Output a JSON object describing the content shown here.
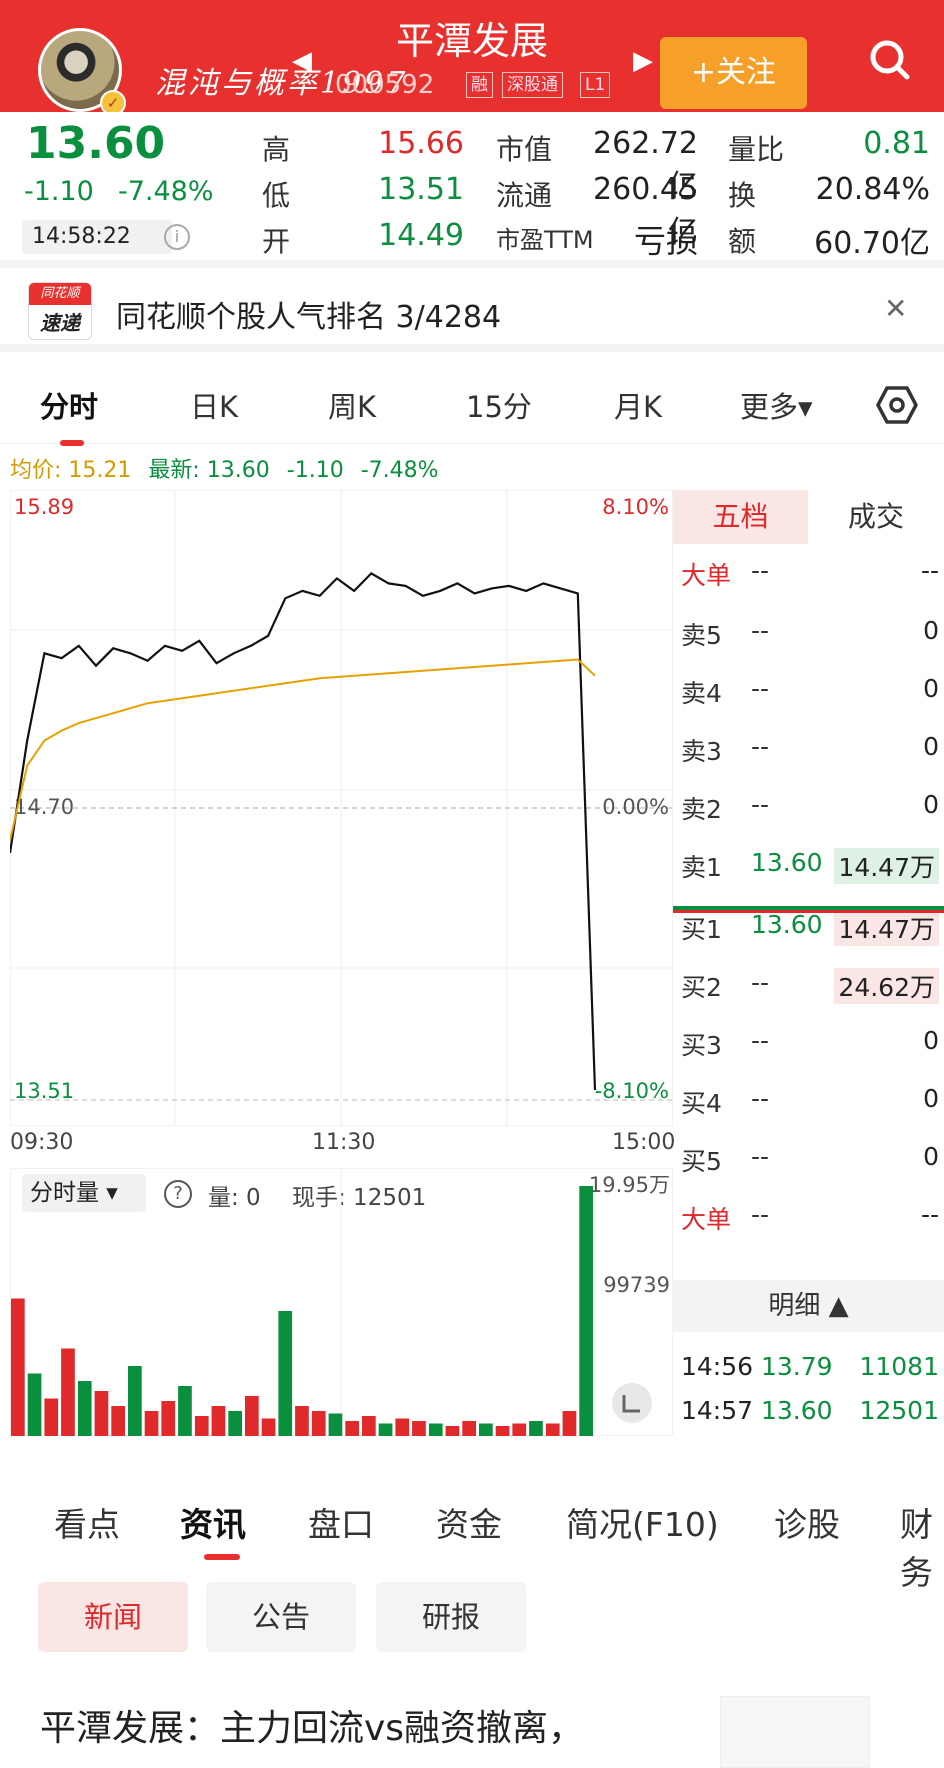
{
  "header": {
    "stock_name": "平潭发展",
    "user_name": "混沌与概率1997",
    "stock_code": "000592",
    "tags": [
      "融",
      "深股通",
      "L1"
    ],
    "follow_label": "+关注",
    "colors": {
      "header_bg": "#e8312f",
      "follow_bg": "#f6a02a"
    }
  },
  "quote": {
    "price": "13.60",
    "change": "-1.10",
    "change_pct": "-7.48%",
    "time": "14:58:22",
    "high_label": "高",
    "high": "15.66",
    "low_label": "低",
    "low": "13.51",
    "open_label": "开",
    "open": "14.49",
    "mktcap_label": "市值",
    "mktcap": "262.72亿",
    "float_label": "流通",
    "float": "260.45亿",
    "pe_label": "市盈TTM",
    "pe": "亏损",
    "volratio_label": "量比",
    "volratio": "0.81",
    "turnover_label": "换",
    "turnover": "20.84%",
    "amount_label": "额",
    "amount": "60.70亿"
  },
  "banner": {
    "logo_top": "同花顺",
    "logo_bottom": "速递",
    "text": "同花顺个股人气排名 3/4284"
  },
  "chart_tabs": [
    "分时",
    "日K",
    "周K",
    "15分",
    "月K",
    "更多▾"
  ],
  "info_line": {
    "avg_label": "均价: 15.21",
    "latest_label": "最新: 13.60",
    "change": "-1.10",
    "pct": "-7.48%"
  },
  "chart_data": {
    "type": "line",
    "y_top": "15.89",
    "y_mid": "14.70",
    "y_bottom": "13.51",
    "pct_top": "8.10%",
    "pct_mid": "0.00%",
    "pct_bottom": "-8.10%",
    "x_ticks": [
      "09:30",
      "11:30",
      "15:00"
    ],
    "ylim": [
      13.51,
      15.89
    ],
    "series": [
      {
        "values": [
          14.5,
          14.95,
          15.3,
          15.28,
          15.33,
          15.25,
          15.32,
          15.3,
          15.27,
          15.33,
          15.31,
          15.35,
          15.26,
          15.3,
          15.33,
          15.37,
          15.52,
          15.55,
          15.53,
          15.6,
          15.55,
          15.62,
          15.58,
          15.57,
          15.53,
          15.55,
          15.58,
          15.54,
          15.56,
          15.57,
          15.55,
          15.58,
          15.56,
          15.54,
          13.55
        ]
      },
      {
        "values": [
          14.55,
          14.85,
          14.95,
          14.99,
          15.02,
          15.04,
          15.06,
          15.08,
          15.1,
          15.11,
          15.12,
          15.13,
          15.14,
          15.15,
          15.16,
          15.17,
          15.18,
          15.19,
          15.2,
          15.205,
          15.21,
          15.215,
          15.22,
          15.225,
          15.23,
          15.235,
          15.24,
          15.245,
          15.25,
          15.255,
          15.26,
          15.265,
          15.27,
          15.275,
          15.21
        ]
      }
    ],
    "volume": {
      "label": "分时量",
      "qty_label": "量: 0",
      "cur_label": "现手: 12501",
      "max_label": "19.95万",
      "mid_label": "99739",
      "values": [
        0.55,
        0.25,
        0.15,
        0.35,
        0.22,
        0.18,
        0.12,
        0.28,
        0.1,
        0.14,
        0.2,
        0.08,
        0.12,
        0.1,
        0.16,
        0.07,
        0.5,
        0.12,
        0.1,
        0.09,
        0.06,
        0.08,
        0.05,
        0.07,
        0.06,
        0.05,
        0.04,
        0.06,
        0.05,
        0.04,
        0.05,
        0.06,
        0.05,
        0.1,
        1.0
      ]
    }
  },
  "order_book": {
    "tab_active": "五档",
    "tab_other": "成交",
    "rows": [
      {
        "label": "大单",
        "price": "--",
        "vol": "--"
      },
      {
        "label": "卖5",
        "price": "--",
        "vol": "0"
      },
      {
        "label": "卖4",
        "price": "--",
        "vol": "0"
      },
      {
        "label": "卖3",
        "price": "--",
        "vol": "0"
      },
      {
        "label": "卖2",
        "price": "--",
        "vol": "0"
      },
      {
        "label": "卖1",
        "price": "13.60",
        "vol": "14.47万"
      },
      {
        "label": "买1",
        "price": "13.60",
        "vol": "14.47万"
      },
      {
        "label": "买2",
        "price": "--",
        "vol": "24.62万"
      },
      {
        "label": "买3",
        "price": "--",
        "vol": "0"
      },
      {
        "label": "买4",
        "price": "--",
        "vol": "0"
      },
      {
        "label": "买5",
        "price": "--",
        "vol": "0"
      },
      {
        "label": "大单",
        "price": "--",
        "vol": "--"
      }
    ],
    "detail_label": "明细 ▲",
    "trades": [
      {
        "time": "14:56",
        "price": "13.79",
        "vol": "11081"
      },
      {
        "time": "14:57",
        "price": "13.60",
        "vol": "12501"
      }
    ]
  },
  "bottom_tabs": [
    "看点",
    "资讯",
    "盘口",
    "资金",
    "简况(F10)",
    "诊股",
    "财务"
  ],
  "news_pills": [
    "新闻",
    "公告",
    "研报"
  ],
  "news_title": "平潭发展：主力回流vs融资撤离，"
}
